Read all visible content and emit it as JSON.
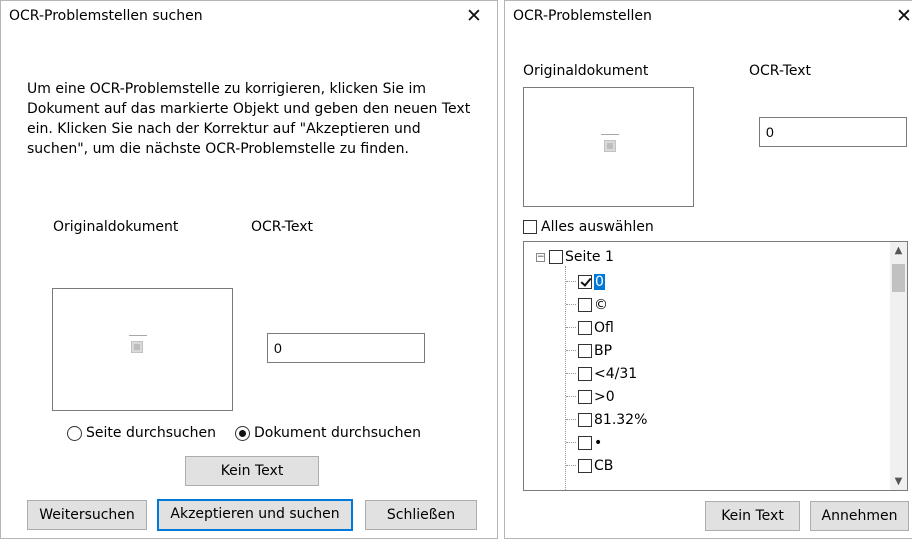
{
  "search_dialog": {
    "title": "OCR-Problemstellen suchen",
    "close_glyph": "✕",
    "description": "Um eine OCR-Problemstelle zu korrigieren, klicken Sie im Dokument auf das markierte Objekt und geben den neuen Text ein. Klicken Sie nach der Korrektur auf \"Akzeptieren und suchen\", um die nächste OCR-Problemstelle zu finden.",
    "original_label": "Originaldokument",
    "ocr_label": "OCR-Text",
    "ocr_value": "0",
    "radio_page": "Seite durchsuchen",
    "radio_document": "Dokument durchsuchen",
    "no_text_button": "Kein Text",
    "continue_button": "Weitersuchen",
    "accept_button": "Akzeptieren und suchen",
    "close_button": "Schließen"
  },
  "problems_dialog": {
    "title": "OCR-Problemstellen",
    "close_glyph": "✕",
    "original_label": "Originaldokument",
    "ocr_label": "OCR-Text",
    "ocr_value": "0",
    "select_all": "Alles auswählen",
    "tree_root": "Seite 1",
    "tree_items": [
      {
        "label": "0",
        "checked": true,
        "selected": true
      },
      {
        "label": "©",
        "checked": false
      },
      {
        "label": "Ofl",
        "checked": false
      },
      {
        "label": "BP",
        "checked": false
      },
      {
        "label": "<4/31",
        "checked": false
      },
      {
        "label": ">0",
        "checked": false
      },
      {
        "label": "81.32%",
        "checked": false
      },
      {
        "label": "•",
        "checked": false
      },
      {
        "label": "CB",
        "checked": false
      }
    ],
    "no_text_button": "Kein Text",
    "accept_button": "Annehmen",
    "scroll_up": "▲",
    "scroll_down": "▼",
    "expander_glyph": "−"
  },
  "colors": {
    "accent": "#0078d7",
    "button_face": "#e1e1e1"
  }
}
